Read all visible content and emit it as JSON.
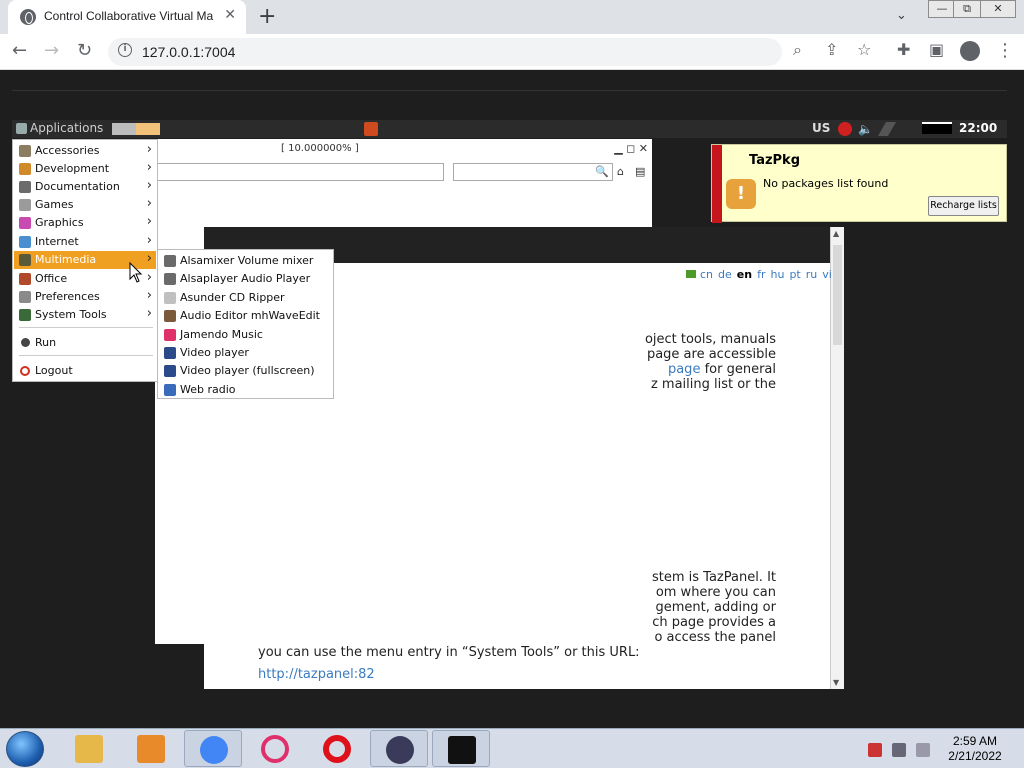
{
  "browser": {
    "tab_title": "Control Collaborative Virtual Ma",
    "tab_close": "✕",
    "new_tab": "+",
    "url": "127.0.0.1:7004",
    "win_min": "—",
    "win_max": "⧉",
    "win_close": "✕"
  },
  "vm_panel": {
    "applications_label": "Applications",
    "keyboard_layout": "US",
    "clock": "22:00"
  },
  "bg_window": {
    "title": "[ 10.000000% ]"
  },
  "notification": {
    "title": "TazPkg",
    "message": "No packages list found",
    "button": "Recharge lists"
  },
  "page": {
    "languages": [
      "cn",
      "de",
      "en",
      "fr",
      "hu",
      "pt",
      "ru",
      "vi"
    ],
    "current_language": "en",
    "lines_block1": [
      "oject tools, manuals",
      "page are accessible",
      "page  for  general",
      "z mailing list or the"
    ],
    "link_word": "page",
    "lines_block2": [
      "stem is TazPanel. It",
      "om  where  you  can",
      "gement,  adding  or",
      "ch page provides a",
      "o access the panel"
    ],
    "url_line": "you can use the menu entry in “System Tools” or this URL:",
    "url_link": "http://tazpanel:82"
  },
  "app_menu": {
    "items": [
      {
        "label": "Accessories",
        "icon": "accessories-icon",
        "color": "#8a7d62",
        "arrow": true
      },
      {
        "label": "Development",
        "icon": "development-icon",
        "color": "#d08a2a",
        "arrow": true
      },
      {
        "label": "Documentation",
        "icon": "documentation-icon",
        "color": "#6b6b6b",
        "arrow": true
      },
      {
        "label": "Games",
        "icon": "games-icon",
        "color": "#9b9b9b",
        "arrow": true
      },
      {
        "label": "Graphics",
        "icon": "graphics-icon",
        "color": "#c84bb2",
        "arrow": true
      },
      {
        "label": "Internet",
        "icon": "internet-icon",
        "color": "#4a8fcf",
        "arrow": true
      },
      {
        "label": "Multimedia",
        "icon": "multimedia-icon",
        "color": "#5a5a3a",
        "arrow": true,
        "selected": true
      },
      {
        "label": "Office",
        "icon": "office-icon",
        "color": "#b04a2a",
        "arrow": true
      },
      {
        "label": "Preferences",
        "icon": "preferences-icon",
        "color": "#8a8a8a",
        "arrow": true
      },
      {
        "label": "System Tools",
        "icon": "system-tools-icon",
        "color": "#3a6a3a",
        "arrow": true
      }
    ],
    "run": "Run",
    "logout": "Logout",
    "arrow_glyph": "›"
  },
  "submenu": {
    "items": [
      {
        "label": "Alsamixer Volume mixer",
        "icon": "speaker-icon",
        "color": "#6a6a6a"
      },
      {
        "label": "Alsaplayer Audio Player",
        "icon": "speaker-icon",
        "color": "#6a6a6a"
      },
      {
        "label": "Asunder CD Ripper",
        "icon": "cd-icon",
        "color": "#c0c0c0"
      },
      {
        "label": "Audio Editor mhWaveEdit",
        "icon": "wave-icon",
        "color": "#7a5a3a"
      },
      {
        "label": "Jamendo Music",
        "icon": "jamendo-icon",
        "color": "#e0306a"
      },
      {
        "label": "Video player",
        "icon": "film-icon",
        "color": "#2a4a8a"
      },
      {
        "label": "Video player (fullscreen)",
        "icon": "film-icon",
        "color": "#2a4a8a"
      },
      {
        "label": "Web radio",
        "icon": "music-note-icon",
        "color": "#3a6aba"
      }
    ]
  },
  "taskbar": {
    "time": "2:59 AM",
    "date": "2/21/2022",
    "apps": [
      {
        "name": "file-explorer-icon",
        "color": "#e6b84a"
      },
      {
        "name": "media-player-icon",
        "color": "#e98a2a"
      },
      {
        "name": "chrome-icon",
        "color": "#4285f4",
        "active": true
      },
      {
        "name": "opera-gx-icon",
        "color": "#e0306a"
      },
      {
        "name": "opera-icon",
        "color": "#e0101a"
      },
      {
        "name": "obs-icon",
        "color": "#3a3a5a",
        "active": true
      },
      {
        "name": "terminal-icon",
        "color": "#111111",
        "active": true
      }
    ]
  }
}
